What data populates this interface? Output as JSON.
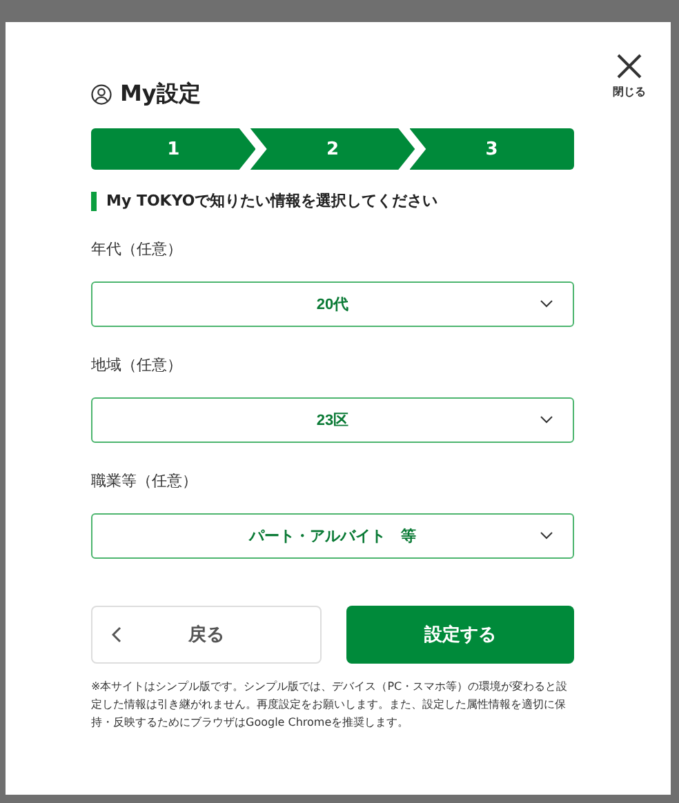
{
  "dialog": {
    "close_label": "閉じる",
    "title": "My設定",
    "steps": [
      {
        "label": "1",
        "active": true
      },
      {
        "label": "2",
        "active": true
      },
      {
        "label": "3",
        "active": true
      }
    ],
    "section_heading": "My TOKYOで知りたい情報を選択してください",
    "fields": [
      {
        "label": "年代（任意）",
        "value": "20代"
      },
      {
        "label": "地域（任意）",
        "value": "23区"
      },
      {
        "label": "職業等（任意）",
        "value": "パート・アルバイト　等"
      }
    ],
    "back_button": "戻る",
    "submit_button": "設定する",
    "note": "※本サイトはシンプル版です。シンプル版では、デバイス（PC・スマホ等）の環境が変わると設定した情報は引き継がれません。再度設定をお願いします。また、設定した属性情報を適切に保持・反映するためにブラウザはGoogle Chromeを推奨します。"
  }
}
